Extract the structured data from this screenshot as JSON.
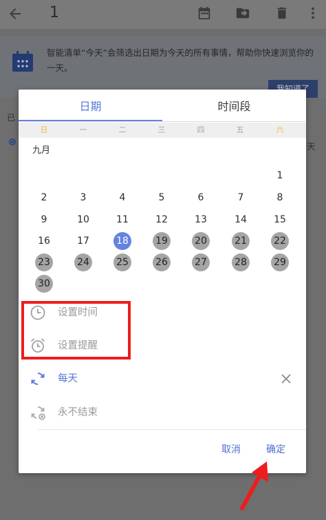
{
  "background": {
    "title": "1",
    "banner_text": "智能清单“今天”会筛选出日期为今天的所有事情，帮助你快速浏览你的一天。",
    "got_it_label": "我知道了",
    "section_label": "已",
    "right_text": "天"
  },
  "dialog": {
    "tabs": [
      "日期",
      "时间段"
    ],
    "weekdays": [
      "日",
      "一",
      "二",
      "三",
      "四",
      "五",
      "六"
    ],
    "month_label": "九月",
    "days": [
      {
        "label": "1",
        "state": "normal"
      },
      {
        "label": "2",
        "state": "normal"
      },
      {
        "label": "3",
        "state": "normal"
      },
      {
        "label": "4",
        "state": "normal"
      },
      {
        "label": "5",
        "state": "normal"
      },
      {
        "label": "6",
        "state": "normal"
      },
      {
        "label": "7",
        "state": "normal"
      },
      {
        "label": "8",
        "state": "normal"
      },
      {
        "label": "9",
        "state": "normal"
      },
      {
        "label": "10",
        "state": "normal"
      },
      {
        "label": "11",
        "state": "normal"
      },
      {
        "label": "12",
        "state": "normal"
      },
      {
        "label": "13",
        "state": "normal"
      },
      {
        "label": "14",
        "state": "normal"
      },
      {
        "label": "15",
        "state": "normal"
      },
      {
        "label": "16",
        "state": "normal"
      },
      {
        "label": "17",
        "state": "normal"
      },
      {
        "label": "18",
        "state": "today"
      },
      {
        "label": "19",
        "state": "selected"
      },
      {
        "label": "20",
        "state": "selected"
      },
      {
        "label": "21",
        "state": "selected"
      },
      {
        "label": "22",
        "state": "selected"
      },
      {
        "label": "23",
        "state": "selected"
      },
      {
        "label": "24",
        "state": "selected"
      },
      {
        "label": "25",
        "state": "selected"
      },
      {
        "label": "26",
        "state": "selected"
      },
      {
        "label": "27",
        "state": "selected"
      },
      {
        "label": "28",
        "state": "selected"
      },
      {
        "label": "29",
        "state": "selected"
      },
      {
        "label": "30",
        "state": "selected"
      }
    ],
    "options": {
      "set_time": "设置时间",
      "set_reminder": "设置提醒",
      "repeat": "每天",
      "end_repeat": "永不结束"
    },
    "buttons": {
      "cancel": "取消",
      "confirm": "确定"
    }
  },
  "colors": {
    "accent": "#5b78d8",
    "today": "#6383e0",
    "selected_range": "#a5a5a5",
    "weekend": "#f0b64b",
    "annotation_red": "#ee1d1d"
  }
}
